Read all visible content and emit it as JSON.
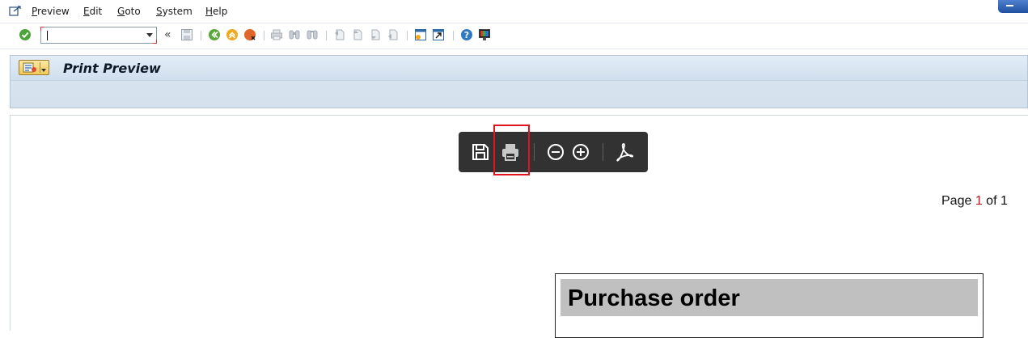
{
  "menu": {
    "items": [
      {
        "label": "Preview"
      },
      {
        "label": "Edit"
      },
      {
        "label": "Goto"
      },
      {
        "label": "System"
      },
      {
        "label": "Help"
      }
    ]
  },
  "toolbar": {
    "command_field_value": "",
    "history_chevron": "«"
  },
  "screen": {
    "title": "Print Preview"
  },
  "pdf_toolbar": {
    "icons": [
      "save-icon",
      "print-icon",
      "zoom-out-icon",
      "zoom-in-icon",
      "acrobat-icon"
    ]
  },
  "page_indicator": {
    "prefix": "Page ",
    "current": "1",
    "middle": " of ",
    "total": "1"
  },
  "document": {
    "heading": "Purchase order"
  },
  "colors": {
    "pdf_toolbar_bg": "#323232",
    "highlight": "#e0141e",
    "page_current": "#c0141e",
    "heading_box": "#c0c0c0"
  }
}
